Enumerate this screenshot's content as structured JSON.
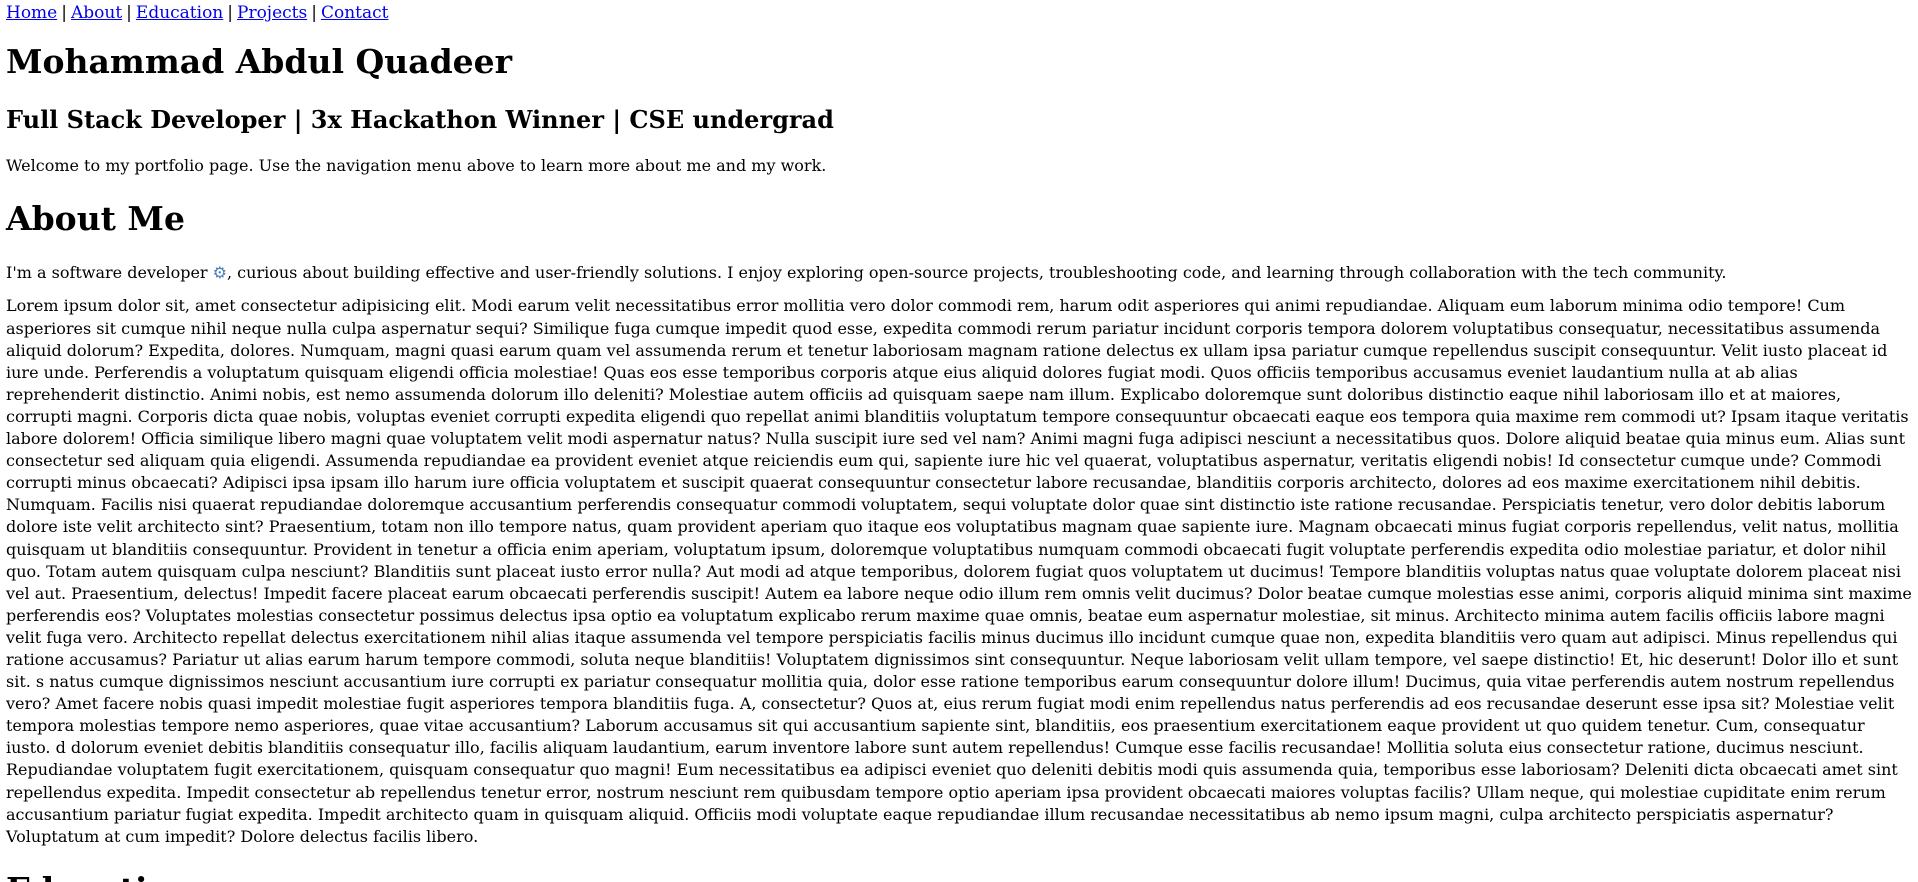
{
  "nav": {
    "items": [
      {
        "label": "Home"
      },
      {
        "label": "About"
      },
      {
        "label": "Education"
      },
      {
        "label": "Projects"
      },
      {
        "label": "Contact"
      }
    ],
    "separator": "|"
  },
  "header": {
    "name": "Mohammad Abdul Quadeer",
    "tagline": "Full Stack Developer | 3x Hackathon Winner | CSE undergrad",
    "welcome": "Welcome to my portfolio page. Use the navigation menu above to learn more about me and my work."
  },
  "about": {
    "heading": "About Me",
    "intro_before_icon": "I'm a software developer ",
    "icon": "gear-icon",
    "icon_glyph": "⚙",
    "intro_after_icon": ", curious about building effective and user-friendly solutions. I enjoy exploring open-source projects, troubleshooting code, and learning through collaboration with the tech community.",
    "body": "Lorem ipsum dolor sit, amet consectetur adipisicing elit. Modi earum velit necessitatibus error mollitia vero dolor commodi rem, harum odit asperiores qui animi repudiandae. Aliquam eum laborum minima odio tempore! Cum asperiores sit cumque nihil neque nulla culpa aspernatur sequi? Similique fuga cumque impedit quod esse, expedita commodi rerum pariatur incidunt corporis tempora dolorem voluptatibus consequatur, necessitatibus assumenda aliquid dolorum? Expedita, dolores. Numquam, magni quasi earum quam vel assumenda rerum et tenetur laboriosam magnam ratione delectus ex ullam ipsa pariatur cumque repellendus suscipit consequuntur. Velit iusto placeat id iure unde. Perferendis a voluptatum quisquam eligendi officia molestiae! Quas eos esse temporibus corporis atque eius aliquid dolores fugiat modi. Quos officiis temporibus accusamus eveniet laudantium nulla at ab alias reprehenderit distinctio. Animi nobis, est nemo assumenda dolorum illo deleniti? Molestiae autem officiis ad quisquam saepe nam illum. Explicabo doloremque sunt doloribus distinctio eaque nihil laboriosam illo et at maiores, corrupti magni. Corporis dicta quae nobis, voluptas eveniet corrupti expedita eligendi quo repellat animi blanditiis voluptatum tempore consequuntur obcaecati eaque eos tempora quia maxime rem commodi ut? Ipsam itaque veritatis labore dolorem! Officia similique libero magni quae voluptatem velit modi aspernatur natus? Nulla suscipit iure sed vel nam? Animi magni fuga adipisci nesciunt a necessitatibus quos. Dolore aliquid beatae quia minus eum. Alias sunt consectetur sed aliquam quia eligendi. Assumenda repudiandae ea provident eveniet atque reiciendis eum qui, sapiente iure hic vel quaerat, voluptatibus aspernatur, veritatis eligendi nobis! Id consectetur cumque unde? Commodi corrupti minus obcaecati? Adipisci ipsa ipsam illo harum iure officia voluptatem et suscipit quaerat consequuntur consectetur labore recusandae, blanditiis corporis architecto, dolores ad eos maxime exercitationem nihil debitis. Numquam. Facilis nisi quaerat repudiandae doloremque accusantium perferendis consequatur commodi voluptatem, sequi voluptate dolor quae sint distinctio iste ratione recusandae. Perspiciatis tenetur, vero dolor debitis laborum dolore iste velit architecto sint? Praesentium, totam non illo tempore natus, quam provident aperiam quo itaque eos voluptatibus magnam quae sapiente iure. Magnam obcaecati minus fugiat corporis repellendus, velit natus, mollitia quisquam ut blanditiis consequuntur. Provident in tenetur a officia enim aperiam, voluptatum ipsum, doloremque voluptatibus numquam commodi obcaecati fugit voluptate perferendis expedita odio molestiae pariatur, et dolor nihil quo. Totam autem quisquam culpa nesciunt? Blanditiis sunt placeat iusto error nulla? Aut modi ad atque temporibus, dolorem fugiat quos voluptatem ut ducimus! Tempore blanditiis voluptas natus quae voluptate dolorem placeat nisi vel aut. Praesentium, delectus! Impedit facere placeat earum obcaecati perferendis suscipit! Autem ea labore neque odio illum rem omnis velit ducimus? Dolor beatae cumque molestias esse animi, corporis aliquid minima sint maxime perferendis eos? Voluptates molestias consectetur possimus delectus ipsa optio ea voluptatum explicabo rerum maxime quae omnis, beatae eum aspernatur molestiae, sit minus. Architecto minima autem facilis officiis labore magni velit fuga vero. Architecto repellat delectus exercitationem nihil alias itaque assumenda vel tempore perspiciatis facilis minus ducimus illo incidunt cumque quae non, expedita blanditiis vero quam aut adipisci. Minus repellendus qui ratione accusamus? Pariatur ut alias earum harum tempore commodi, soluta neque blanditiis! Voluptatem dignissimos sint consequuntur. Neque laboriosam velit ullam tempore, vel saepe distinctio! Et, hic deserunt! Dolor illo et sunt sit. s natus cumque dignissimos nesciunt accusantium iure corrupti ex pariatur consequatur mollitia quia, dolor esse ratione temporibus earum consequuntur dolore illum! Ducimus, quia vitae perferendis autem nostrum repellendus vero? Amet facere nobis quasi impedit molestiae fugit asperiores tempora blanditiis fuga. A, consectetur? Quos at, eius rerum fugiat modi enim repellendus natus perferendis ad eos recusandae deserunt esse ipsa sit? Molestiae velit tempora molestias tempore nemo asperiores, quae vitae accusantium? Laborum accusamus sit qui accusantium sapiente sint, blanditiis, eos praesentium exercitationem eaque provident ut quo quidem tenetur. Cum, consequatur iusto. d dolorum eveniet debitis blanditiis consequatur illo, facilis aliquam laudantium, earum inventore labore sunt autem repellendus! Cumque esse facilis recusandae! Mollitia soluta eius consectetur ratione, ducimus nesciunt. Repudiandae voluptatem fugit exercitationem, quisquam consequatur quo magni! Eum necessitatibus ea adipisci eveniet quo deleniti debitis modi quis assumenda quia, temporibus esse laboriosam? Deleniti dicta obcaecati amet sint repellendus expedita. Impedit consectetur ab repellendus tenetur error, nostrum nesciunt rem quibusdam tempore optio aperiam ipsa provident obcaecati maiores voluptas facilis? Ullam neque, qui molestiae cupiditate enim rerum accusantium pariatur fugiat expedita. Impedit architecto quam in quisquam aliquid. Officiis modi voluptate eaque repudiandae illum recusandae necessitatibus ab nemo ipsum magni, culpa architecto perspiciatis aspernatur? Voluptatum at cum impedit? Dolore delectus facilis libero."
  },
  "education": {
    "heading": "Education"
  },
  "colors": {
    "link": "#0000ee",
    "text": "#000000",
    "background": "#ffffff"
  }
}
